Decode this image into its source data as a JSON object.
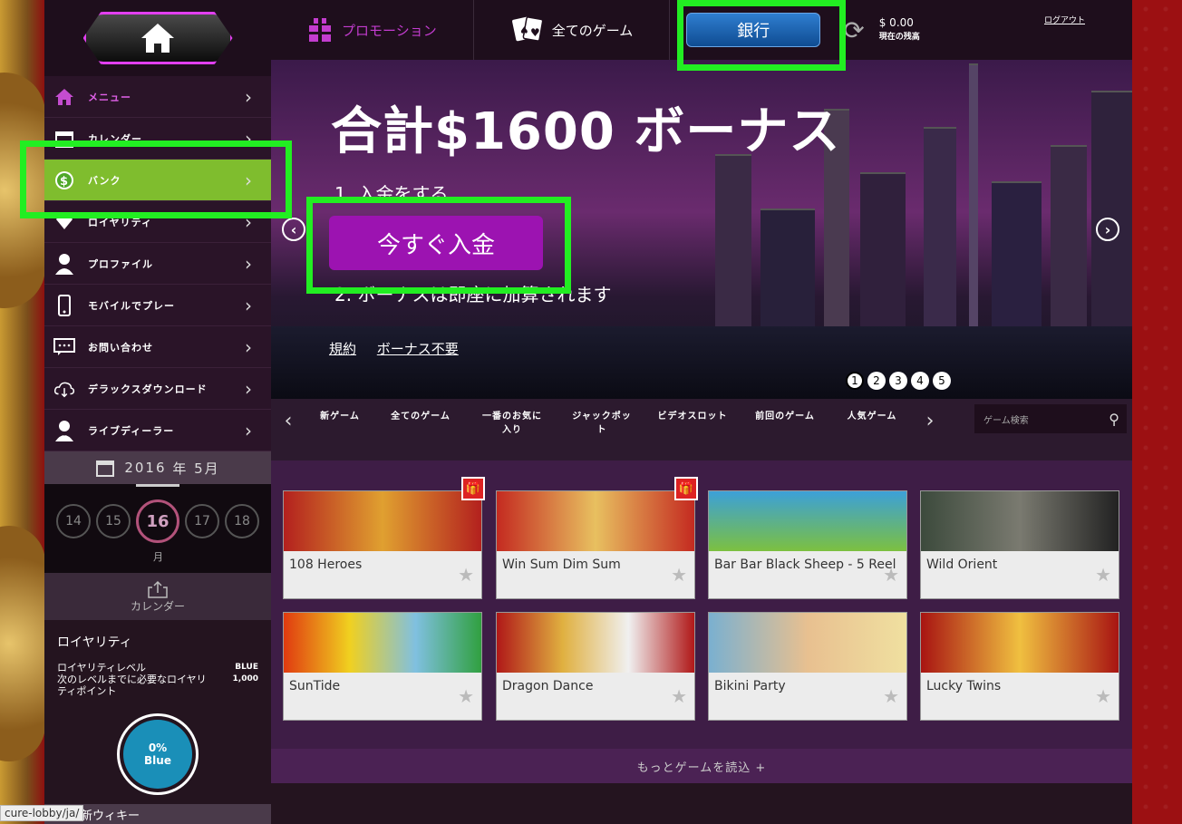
{
  "sidebar": {
    "items": [
      {
        "label": "メニュー",
        "icon": "home-icon"
      },
      {
        "label": "カレンダー",
        "icon": "calendar-icon"
      },
      {
        "label": "バンク",
        "icon": "dollar-icon"
      },
      {
        "label": "ロイヤリティ",
        "icon": "diamond-icon"
      },
      {
        "label": "プロファイル",
        "icon": "user-icon"
      },
      {
        "label": "モバイルでプレー",
        "icon": "mobile-icon"
      },
      {
        "label": "お問い合わせ",
        "icon": "chat-icon"
      },
      {
        "label": "デラックスダウンロード",
        "icon": "cloud-download-icon"
      },
      {
        "label": "ライブディーラー",
        "icon": "dealer-icon"
      }
    ],
    "calendar": {
      "year": "2016",
      "year_unit": "年",
      "month": "5月",
      "days": [
        "14",
        "15",
        "16",
        "17",
        "18"
      ],
      "today": "16",
      "month_label": "月",
      "link_label": "カレンダー"
    },
    "loyalty": {
      "title": "ロイヤリティ",
      "level_label": "ロイヤリティレベル",
      "level_value": "BLUE",
      "points_label": "次のレベルまでに必要なロイヤリティポイント",
      "points_value": "1,000",
      "gauge_percent": "0%",
      "gauge_level": "Blue"
    },
    "news_label": "新ウィキー",
    "status_url": "cure-lobby/ja/"
  },
  "topnav": {
    "promo": "プロモーション",
    "all_games": "全てのゲーム",
    "bank": "銀行",
    "balance": "$ 0.00",
    "balance_label": "現在の残高",
    "logout": "ログアウト"
  },
  "banner": {
    "title": "合計$1600 ボーナス",
    "step1": "1. 入金をする",
    "deposit_button": "今すぐ入金",
    "step2": "2. ボーナスは即座に加算されます",
    "link_terms": "規約",
    "link_nobonus": "ボーナス不要",
    "pages": [
      "1",
      "2",
      "3",
      "4",
      "5"
    ],
    "current_page": "1"
  },
  "categories": [
    "新ゲーム",
    "全てのゲーム",
    "一番のお気に入り",
    "ジャックポット",
    "ビデオスロット",
    "前回のゲーム",
    "人気ゲーム"
  ],
  "search_placeholder": "ゲーム検索",
  "games": [
    {
      "name": "108 Heroes",
      "gift": true,
      "thumb": "#b3201e"
    },
    {
      "name": "Win Sum Dim Sum",
      "gift": true,
      "thumb": "#c42a20"
    },
    {
      "name": "Bar Bar Black Sheep - 5 Reel",
      "gift": false,
      "thumb": "#3ca0d8"
    },
    {
      "name": "Wild Orient",
      "gift": false,
      "thumb": "#3c4a3c"
    },
    {
      "name": "SunTide",
      "gift": false,
      "thumb": "#e03a10"
    },
    {
      "name": "Dragon Dance",
      "gift": false,
      "thumb": "#b01818"
    },
    {
      "name": "Bikini Party",
      "gift": false,
      "thumb": "#7ab0d0"
    },
    {
      "name": "Lucky Twins",
      "gift": false,
      "thumb": "#a81412"
    }
  ],
  "load_more": "もっとゲームを読込 +",
  "colors": {
    "accent": "#9c13b1",
    "bank_active": "#7fbd2e",
    "highlight": "#22ee22",
    "bank_button": "#1f66b8"
  }
}
